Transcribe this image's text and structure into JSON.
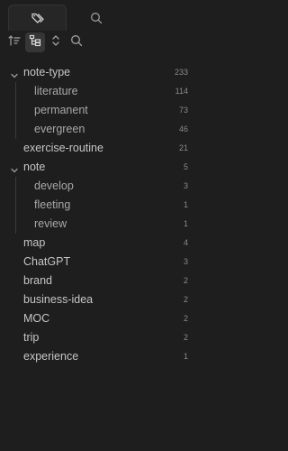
{
  "tabs": [
    {
      "icon": "tags-icon",
      "active": true
    },
    {
      "icon": "search-icon",
      "active": false
    }
  ],
  "toolbar": [
    {
      "icon": "sort-icon"
    },
    {
      "icon": "tree-view-icon",
      "selected": true
    },
    {
      "icon": "expand-collapse-icon"
    },
    {
      "icon": "search-icon"
    }
  ],
  "tree": [
    {
      "label": "note-type",
      "count": "233",
      "level": 0,
      "expanded": true
    },
    {
      "label": "literature",
      "count": "114",
      "level": 1
    },
    {
      "label": "permanent",
      "count": "73",
      "level": 1
    },
    {
      "label": "evergreen",
      "count": "46",
      "level": 1
    },
    {
      "label": "exercise-routine",
      "count": "21",
      "level": 0
    },
    {
      "label": "note",
      "count": "5",
      "level": 0,
      "expanded": true
    },
    {
      "label": "develop",
      "count": "3",
      "level": 1
    },
    {
      "label": "fleeting",
      "count": "1",
      "level": 1
    },
    {
      "label": "review",
      "count": "1",
      "level": 1
    },
    {
      "label": "map",
      "count": "4",
      "level": 0
    },
    {
      "label": "ChatGPT",
      "count": "3",
      "level": 0
    },
    {
      "label": "brand",
      "count": "2",
      "level": 0
    },
    {
      "label": "business-idea",
      "count": "2",
      "level": 0
    },
    {
      "label": "MOC",
      "count": "2",
      "level": 0
    },
    {
      "label": "trip",
      "count": "2",
      "level": 0
    },
    {
      "label": "experience",
      "count": "1",
      "level": 0
    }
  ],
  "colors": {
    "background": "#1e1e1e",
    "text": "#c6c6c6",
    "muted": "#8a8a8a"
  }
}
